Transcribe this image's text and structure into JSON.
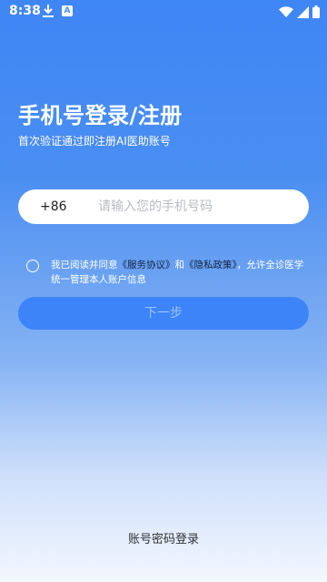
{
  "status_bar": {
    "time": "8:38",
    "app_badge": "A"
  },
  "login": {
    "title": "手机号登录/注册",
    "subtitle": "首次验证通过即注册AI医助账号",
    "country_code": "+86",
    "phone_placeholder": "请输入您的手机号码",
    "agreement": {
      "prefix": "我已阅读并同意",
      "service_link": "《服务协议》",
      "and": "和",
      "privacy_link": "《隐私政策》",
      "suffix": "，允许全诊医学统一管理本人账户信息"
    },
    "next_label": "下一步",
    "account_login_label": "账号密码登录"
  },
  "colors": {
    "accent": "#3c84f7",
    "link": "#14213d"
  }
}
